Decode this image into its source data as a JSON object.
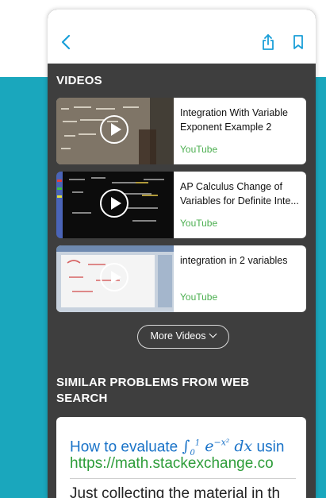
{
  "header": {
    "back_icon": "chevron-left-icon",
    "share_icon": "share-icon",
    "bookmark_icon": "bookmark-icon",
    "accent": "#1aa7bd"
  },
  "videos": {
    "section_title": "VIDEOS",
    "items": [
      {
        "title": "Integration With Variable Exponent Example 2",
        "title_line1": "Integration With Variable",
        "title_line2": "Exponent Example 2",
        "source": "YouTube"
      },
      {
        "title": "AP Calculus Change of Variables for Definite Inte...",
        "title_line1": "AP Calculus Change of",
        "title_line2": "Variables for Definite Inte...",
        "source": "YouTube"
      },
      {
        "title": "integration in 2 variables",
        "title_line1": "integration in 2 variables",
        "source": "YouTube"
      }
    ],
    "more_label": "More Videos"
  },
  "similar": {
    "section_title": "SIMILAR PROBLEMS FROM WEB SEARCH",
    "result": {
      "title_prefix": "How to evaluate ",
      "title_suffix": "usin",
      "url": "https://math.stackexchange.co",
      "snippet": "Just collecting the material in th"
    }
  },
  "colors": {
    "sheet_bg": "#3e3e3e",
    "source_green": "#4caf50",
    "link_blue": "#1a73c8",
    "url_green": "#2e9d3a"
  }
}
